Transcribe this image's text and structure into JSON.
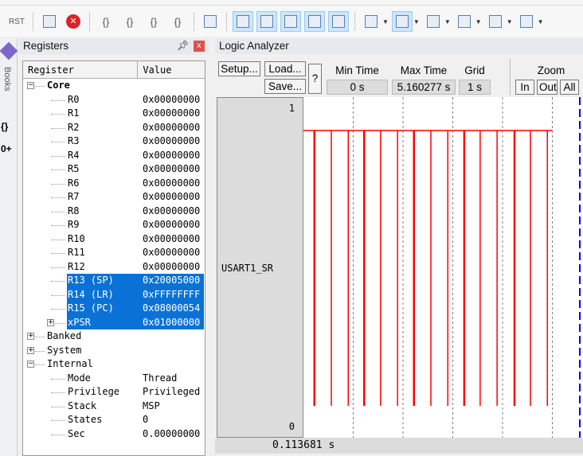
{
  "toolbar": {
    "items": [
      {
        "icon": "reset-icon",
        "label": "RST"
      },
      {
        "icon": "step-list-icon"
      },
      {
        "icon": "stop-icon"
      },
      {
        "icon": "step-into-icon",
        "label": "{}"
      },
      {
        "icon": "step-over-icon",
        "label": "{}"
      },
      {
        "icon": "step-out-icon",
        "label": "{}"
      },
      {
        "icon": "run-to-cursor-icon",
        "label": "{}"
      },
      {
        "icon": "show-next-statement-icon"
      },
      {
        "icon": "command-window-icon"
      },
      {
        "icon": "disassembly-window-icon"
      },
      {
        "icon": "symbols-window-icon"
      },
      {
        "icon": "registers-window-icon"
      },
      {
        "icon": "call-stack-icon"
      },
      {
        "icon": "watch-window-icon"
      },
      {
        "icon": "memory-window-icon"
      },
      {
        "icon": "serial-window-icon"
      },
      {
        "icon": "analysis-window-icon"
      },
      {
        "icon": "trace-window-icon"
      },
      {
        "icon": "system-viewer-icon"
      }
    ]
  },
  "leftbar": {
    "books_label": "Books",
    "functions_label": "{}",
    "templates_label": "0+"
  },
  "registers": {
    "title": "Registers",
    "col_register": "Register",
    "col_value": "Value",
    "groups": [
      {
        "name": "Core",
        "expanded": true,
        "rows": [
          {
            "name": "R0",
            "value": "0x00000000"
          },
          {
            "name": "R1",
            "value": "0x00000000"
          },
          {
            "name": "R2",
            "value": "0x00000000"
          },
          {
            "name": "R3",
            "value": "0x00000000"
          },
          {
            "name": "R4",
            "value": "0x00000000"
          },
          {
            "name": "R5",
            "value": "0x00000000"
          },
          {
            "name": "R6",
            "value": "0x00000000"
          },
          {
            "name": "R7",
            "value": "0x00000000"
          },
          {
            "name": "R8",
            "value": "0x00000000"
          },
          {
            "name": "R9",
            "value": "0x00000000"
          },
          {
            "name": "R10",
            "value": "0x00000000"
          },
          {
            "name": "R11",
            "value": "0x00000000"
          },
          {
            "name": "R12",
            "value": "0x00000000"
          },
          {
            "name": "R13 (SP)",
            "value": "0x20005000",
            "selected": true
          },
          {
            "name": "R14 (LR)",
            "value": "0xFFFFFFFF",
            "selected": true
          },
          {
            "name": "R15 (PC)",
            "value": "0x08000054",
            "selected": true
          },
          {
            "name": "xPSR",
            "value": "0x01000000",
            "selected": true,
            "expandable": true
          }
        ]
      },
      {
        "name": "Banked",
        "expanded": false,
        "rows": []
      },
      {
        "name": "System",
        "expanded": false,
        "rows": []
      },
      {
        "name": "Internal",
        "expanded": true,
        "rows": [
          {
            "name": "Mode",
            "value": "Thread"
          },
          {
            "name": "Privilege",
            "value": "Privileged"
          },
          {
            "name": "Stack",
            "value": "MSP"
          },
          {
            "name": "States",
            "value": "0"
          },
          {
            "name": "Sec",
            "value": "0.00000000"
          }
        ]
      }
    ]
  },
  "logic_analyzer": {
    "title": "Logic Analyzer",
    "setup_label": "Setup...",
    "load_label": "Load...",
    "save_label": "Save...",
    "help_label": "?",
    "min_time_label": "Min Time",
    "min_time": "0 s",
    "max_time_label": "Max Time",
    "max_time": "5.160277 s",
    "grid_label": "Grid",
    "grid": "1 s",
    "zoom_label": "Zoom",
    "zoom_in": "In",
    "zoom_out": "Out",
    "zoom_all": "All",
    "cursor_time": "0.113681 s"
  },
  "chart_data": {
    "type": "line",
    "signal": "USART1_SR",
    "y_max_label": "1",
    "y_min_label": "0",
    "xlim": [
      0,
      5.6
    ],
    "grid_interval": 1,
    "grid": true,
    "high_until": 5.0,
    "pulse_times": [
      0.22,
      0.56,
      0.9,
      1.22,
      1.55,
      1.89,
      2.22,
      2.56,
      2.9,
      3.23,
      3.55,
      3.89,
      4.24,
      4.56,
      4.9
    ],
    "colors": {
      "signal": "#ff0000",
      "cursor": "#0000ff",
      "grid": "#808080"
    }
  }
}
